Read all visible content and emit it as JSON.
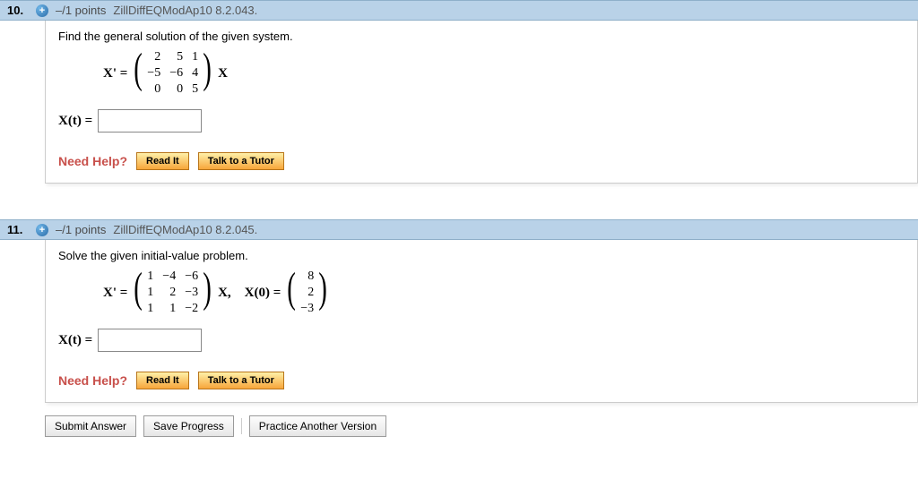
{
  "q10": {
    "number": "10.",
    "expandGlyph": "+",
    "points": "–/1 points",
    "source": "ZillDiffEQModAp10 8.2.043.",
    "prompt": "Find the general solution of the given system.",
    "eqLeft": "X' =",
    "eqRight": "X",
    "matrix": [
      "2",
      "5",
      "1",
      "−5",
      "−6",
      "4",
      "0",
      "0",
      "5"
    ],
    "ansLabel": "X(t) =",
    "help": "Need Help?",
    "readIt": "Read It",
    "talk": "Talk to a Tutor"
  },
  "q11": {
    "number": "11.",
    "expandGlyph": "+",
    "points": "–/1 points",
    "source": "ZillDiffEQModAp10 8.2.045.",
    "prompt": "Solve the given initial-value problem.",
    "eqLeft": "X' =",
    "mid": "X,    X(0) =",
    "matrix": [
      "1",
      "−4",
      "−6",
      "1",
      "2",
      "−3",
      "1",
      "1",
      "−2"
    ],
    "vec": [
      "8",
      "2",
      "−3"
    ],
    "ansLabel": "X(t) =",
    "help": "Need Help?",
    "readIt": "Read It",
    "talk": "Talk to a Tutor"
  },
  "actions": {
    "submit": "Submit Answer",
    "save": "Save Progress",
    "practice": "Practice Another Version"
  }
}
